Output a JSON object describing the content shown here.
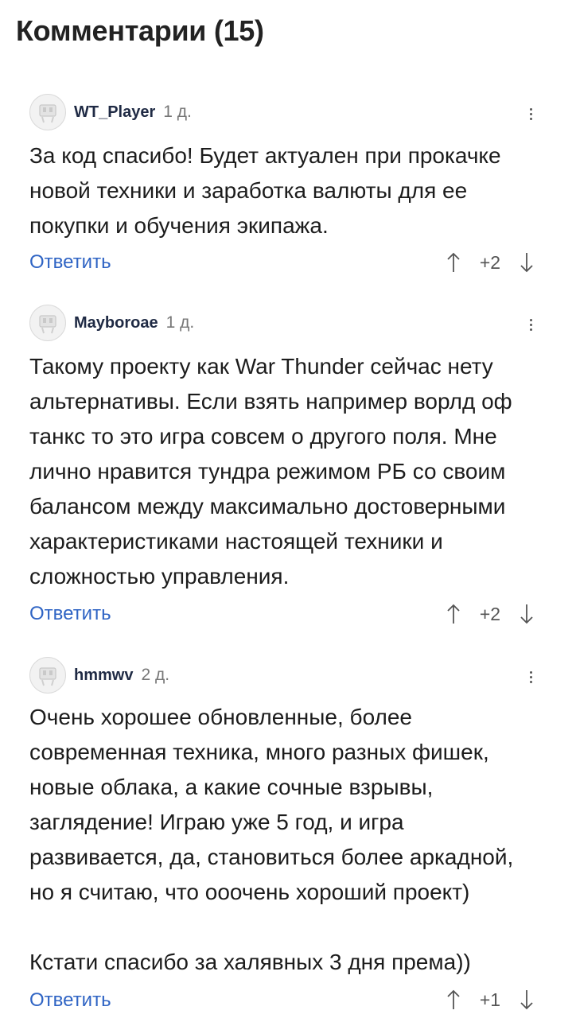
{
  "header": {
    "title": "Комментарии (15)"
  },
  "reply_label": "Ответить",
  "icons": {
    "avatar": "default-avatar-icon",
    "more": "more-vertical-icon",
    "upvote": "arrow-up-icon",
    "downvote": "arrow-down-icon"
  },
  "colors": {
    "link": "#2f64c4",
    "username": "#1f2a44",
    "meta": "#777777"
  },
  "comments": [
    {
      "user": "WT_Player",
      "time": "1 д.",
      "text": "За код спасибо! Будет актуален при прокачке\nновой техники и заработка валюты для ее\nпокупки и обучения экипажа.",
      "score": "+2"
    },
    {
      "user": "Mayboroae",
      "time": "1 д.",
      "text": "Такому проекту как War Thunder сейчас нету\nальтернативы. Если взять например ворлд оф\nтанкс то это игра совсем о другого поля. Мне\nлично нравится тундра режимом РБ со своим\nбалансом между максимально достоверными\nхарактеристиками настоящей техники и\nсложностью управления.",
      "score": "+2"
    },
    {
      "user": "hmmwv",
      "time": "2 д.",
      "text": "Очень хорошее обновленные, более\nсовременная техника, много разных фишек,\nновые облака, а какие сочные взрывы,\nзаглядение! Играю уже 5 год, и игра\nразвивается, да, становиться более аркадной,\nно я считаю, что ооочень хороший проект)\n\nКстати спасибо за халявных 3 дня према))",
      "score": "+1"
    }
  ]
}
